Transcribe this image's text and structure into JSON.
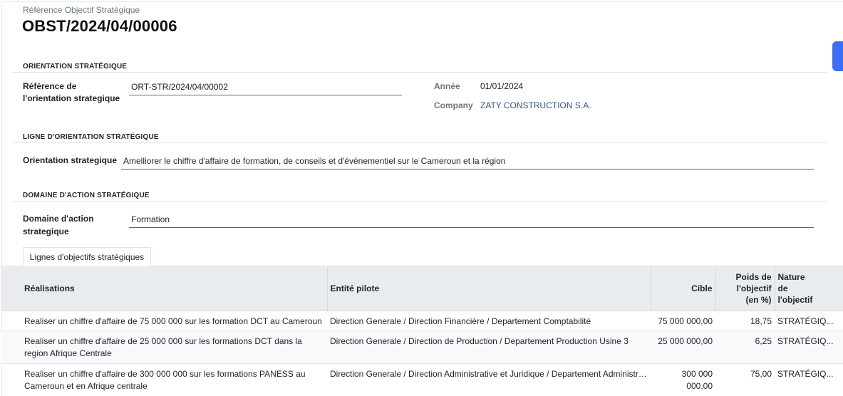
{
  "header": {
    "ref_label": "Référence Objectif Stratégique",
    "ref_title": "OBST/2024/04/00006"
  },
  "orientation_section": {
    "title": "ORIENTATION STRATÉGIQUE",
    "ref_label_line1": "Référence de",
    "ref_label_line2": "l'orientation strategique",
    "ref_value": "ORT-STR/2024/04/00002",
    "year_label": "Année",
    "year_value": "01/01/2024",
    "company_label": "Company",
    "company_value": "ZATY CONSTRUCTION S.A."
  },
  "ligne_section": {
    "title": "LIGNE D'ORIENTATION STRATÉGIQUE",
    "label": "Orientation strategique",
    "value": "Amelliorer le chiffre d'affaire de formation, de conseils et d'évènementiel sur le Cameroun et la région"
  },
  "domaine_section": {
    "title": "DOMAINE D'ACTION STRATÉGIQUE",
    "label_line1": "Domaine d'action",
    "label_line2": "strategique",
    "value": "Formation"
  },
  "tab": {
    "label": "Lignes d'objectifs stratégiques"
  },
  "table": {
    "headers": {
      "realisations": "Réalisations",
      "entite": "Entité pilote",
      "cible": "Cible",
      "poids_l1": "Poids de",
      "poids_l2": "l'objectif",
      "poids_l3": "(en %)",
      "nature_l1": "Nature",
      "nature_l2": "de",
      "nature_l3": "l'objectif"
    },
    "rows": [
      {
        "realisation": "Realiser un chiffre d'affaire de 75 000 000 sur les formation DCT au Cameroun",
        "entite": "Direction Generale / Direction Financière / Departement Comptabilité",
        "cible": "75 000 000,00",
        "poids": "18,75",
        "nature": "STRATÉGIQ..."
      },
      {
        "realisation": "Realiser un chiffre d'affaire de 25 000 000 sur les formations DCT dans la region Afrique Centrale",
        "entite": "Direction Generale / Direction de Production / Departement Production Usine 3",
        "cible": "25 000 000,00",
        "poids": "6,25",
        "nature": "STRATÉGIQ..."
      },
      {
        "realisation": "Realiser un chiffre d'affaire de 300 000 000  sur les formations PANESS au Cameroun et en Afrique centrale",
        "entite": "Direction Generale / Direction Administrative et Juridique / Departement Administrat...",
        "cible": "300 000 000,00",
        "poids": "75,00",
        "nature": "STRATÉGIQ..."
      }
    ]
  }
}
